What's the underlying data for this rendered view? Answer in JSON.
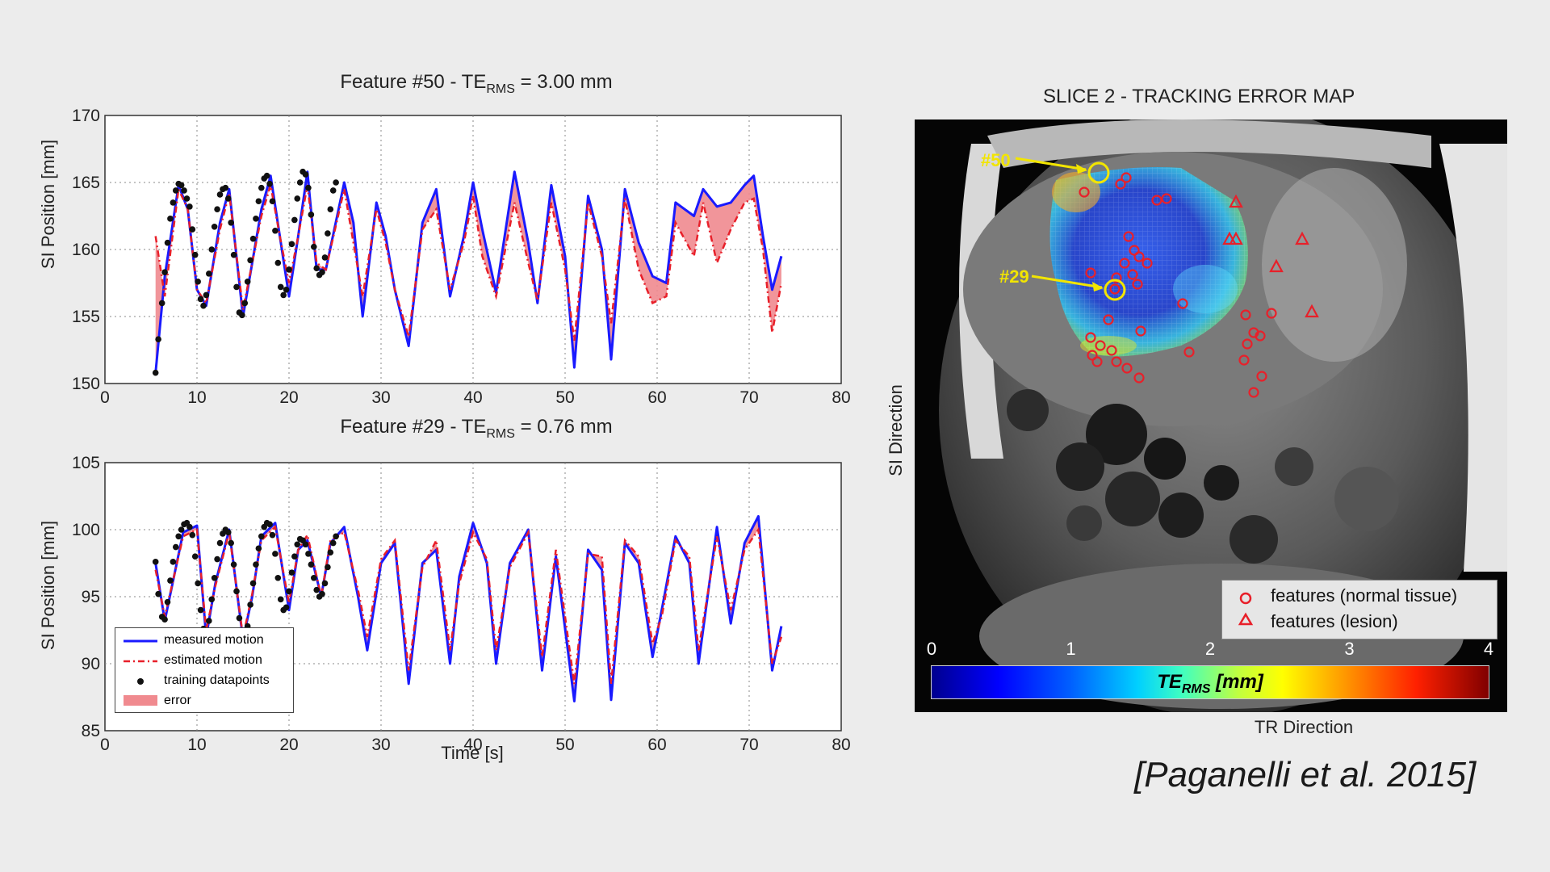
{
  "colors": {
    "measured": "#1a1aff",
    "estimated": "#e8202a",
    "training": "#111111",
    "error_fill": "#f08a8f",
    "feature_marker": "#e8202a",
    "highlight": "#f2e500"
  },
  "chart_data": [
    {
      "type": "line",
      "title_main": "Feature #50 - TE",
      "title_sub": "RMS",
      "title_tail": " = 3.00 mm",
      "xlabel": "",
      "ylabel": "SI Position [mm]",
      "xlim": [
        0,
        80
      ],
      "ylim": [
        150,
        170
      ],
      "xticks": [
        0,
        10,
        20,
        30,
        40,
        50,
        60,
        70,
        80
      ],
      "yticks": [
        150,
        155,
        160,
        165,
        170
      ],
      "grid": true,
      "series": [
        {
          "key": "measured",
          "values_x": [
            5.5,
            6.5,
            8,
            9,
            10,
            11,
            12.5,
            13.5,
            15,
            16,
            17,
            18,
            19,
            20,
            21,
            22,
            23,
            24,
            26,
            27,
            28,
            29.5,
            30.5,
            31.5,
            33,
            34.5,
            36,
            37.5,
            39,
            40,
            41,
            42.5,
            44.5,
            46,
            47,
            48.5,
            50,
            51,
            52.5,
            54,
            55,
            56.5,
            58,
            59.5,
            61,
            62,
            64,
            65,
            66.5,
            68,
            69.5,
            70.5,
            71.5,
            72.5,
            73.5
          ],
          "values_y": [
            150.8,
            158,
            164.8,
            163,
            157,
            155.8,
            162,
            164.5,
            155,
            159,
            163,
            165.5,
            161,
            156.5,
            161,
            165.8,
            158.5,
            158.5,
            165,
            162,
            155,
            163.5,
            161,
            157,
            152.8,
            162,
            164.5,
            156.5,
            161,
            165,
            161.5,
            156.8,
            165.8,
            160.5,
            156,
            164.8,
            159.5,
            151.2,
            164,
            160,
            151.8,
            164.5,
            160.5,
            158,
            157.5,
            163.5,
            162.5,
            164.5,
            163.2,
            163.5,
            164.8,
            165.5,
            161,
            157,
            159.5
          ]
        },
        {
          "key": "estimated",
          "values_x": [
            5.5,
            6.5,
            8,
            9,
            10,
            11,
            12.5,
            13.5,
            15,
            16,
            17,
            18,
            19,
            20,
            21,
            22,
            23,
            24,
            26,
            27,
            28,
            29.5,
            30.5,
            31.5,
            33,
            34.5,
            36,
            37.5,
            39,
            40,
            41,
            42.5,
            44.5,
            46,
            47,
            48.5,
            50,
            51,
            52.5,
            54,
            55,
            56.5,
            58,
            59.5,
            61,
            62,
            64,
            65,
            66.5,
            68,
            69.5,
            70.5,
            71.5,
            72.5,
            73.5
          ],
          "values_y": [
            161,
            156.5,
            164.5,
            163,
            157,
            156,
            161.5,
            164.2,
            155.5,
            159,
            162.5,
            164.8,
            161,
            157.5,
            161,
            164.8,
            159,
            158.5,
            164.5,
            160.5,
            156.5,
            163,
            160.5,
            157,
            153.5,
            161.5,
            163,
            157,
            160.5,
            164,
            159.5,
            156.5,
            163.5,
            159,
            156.2,
            163.5,
            158.5,
            153.2,
            163.5,
            159.5,
            154.5,
            163.8,
            158.5,
            156,
            156.5,
            162,
            159.5,
            163.5,
            159,
            161.5,
            163.5,
            163.8,
            160,
            153.8,
            157.5
          ]
        },
        {
          "key": "training",
          "values_x": [
            5.5,
            5.8,
            6.2,
            6.5,
            6.8,
            7.1,
            7.4,
            7.7,
            8,
            8.3,
            8.6,
            8.9,
            9.2,
            9.5,
            9.8,
            10.1,
            10.4,
            10.7,
            11,
            11.3,
            11.6,
            11.9,
            12.2,
            12.5,
            12.8,
            13.1,
            13.4,
            13.7,
            14,
            14.3,
            14.6,
            14.9,
            15.2,
            15.5,
            15.8,
            16.1,
            16.4,
            16.7,
            17,
            17.3,
            17.6,
            17.9,
            18.2,
            18.5,
            18.8,
            19.1,
            19.4,
            19.7,
            20,
            20.3,
            20.6,
            20.9,
            21.2,
            21.5,
            21.8,
            22.1,
            22.4,
            22.7,
            23,
            23.3,
            23.6,
            23.9,
            24.2,
            24.5,
            24.8,
            25.1
          ],
          "values_y": [
            150.8,
            153.3,
            156,
            158.3,
            160.5,
            162.3,
            163.5,
            164.4,
            164.9,
            164.8,
            164.4,
            163.8,
            163.2,
            161.5,
            159.6,
            157.6,
            156.3,
            155.8,
            156.6,
            158.2,
            160,
            161.7,
            163,
            164.1,
            164.5,
            164.6,
            163.8,
            162,
            159.6,
            157.2,
            155.3,
            155.1,
            156,
            157.6,
            159.2,
            160.8,
            162.3,
            163.6,
            164.6,
            165.3,
            165.5,
            164.9,
            163.6,
            161.4,
            159,
            157.2,
            156.6,
            157,
            158.5,
            160.4,
            162.2,
            163.8,
            165,
            165.8,
            165.6,
            164.6,
            162.6,
            160.2,
            158.6,
            158.1,
            158.3,
            159.4,
            161.2,
            163,
            164.4,
            165
          ]
        }
      ]
    },
    {
      "type": "line",
      "title_main": "Feature #29 - TE",
      "title_sub": "RMS",
      "title_tail": " = 0.76 mm",
      "xlabel": "Time [s]",
      "ylabel": "SI Position [mm]",
      "xlim": [
        0,
        80
      ],
      "ylim": [
        85,
        105
      ],
      "xticks": [
        0,
        10,
        20,
        30,
        40,
        50,
        60,
        70,
        80
      ],
      "yticks": [
        85,
        90,
        95,
        100,
        105
      ],
      "grid": true,
      "legend_placement": "bottom-left",
      "legend": [
        "measured motion",
        "estimated motion",
        "training datapoints",
        "error"
      ],
      "series": [
        {
          "key": "measured",
          "values_x": [
            5.5,
            6.5,
            8.5,
            10,
            11,
            12,
            13.5,
            15,
            16,
            17,
            18.5,
            20,
            21,
            22,
            23.5,
            24.5,
            26,
            27.5,
            28.5,
            30,
            31.5,
            33,
            34.5,
            36,
            37.5,
            38.5,
            40,
            41.5,
            42.5,
            44,
            46,
            47.5,
            49,
            51,
            52.5,
            54,
            55,
            56.5,
            58,
            59.5,
            60.5,
            62,
            63.5,
            64.5,
            66.5,
            68,
            69.5,
            71,
            72.5,
            73.5
          ],
          "values_y": [
            97.5,
            93.2,
            99.8,
            100.3,
            92,
            96,
            100,
            91.8,
            95,
            99.5,
            100.5,
            94,
            98.5,
            99.2,
            95,
            99,
            100.2,
            95,
            91,
            97.5,
            99,
            88.5,
            97.5,
            98.5,
            90,
            96.5,
            100.5,
            97.5,
            90,
            97.5,
            100,
            89.5,
            98,
            87.2,
            98.5,
            97,
            87.3,
            99,
            97.5,
            90.5,
            94,
            99.5,
            97.5,
            90,
            100.2,
            93,
            99,
            101,
            89.5,
            92.8
          ]
        },
        {
          "key": "estimated",
          "values_x": [
            5.5,
            6.5,
            8.5,
            10,
            11,
            12,
            13.5,
            15,
            16,
            17,
            18.5,
            20,
            21,
            22,
            23.5,
            24.5,
            26,
            27.5,
            28.5,
            30,
            31.5,
            33,
            34.5,
            36,
            37.5,
            38.5,
            40,
            41.5,
            42.5,
            44,
            46,
            47.5,
            49,
            51,
            52.5,
            54,
            55,
            56.5,
            58,
            59.5,
            60.5,
            62,
            63.5,
            64.5,
            66.5,
            68,
            69.5,
            71,
            72.5,
            73.5
          ],
          "values_y": [
            97,
            93.5,
            99.5,
            100,
            92.5,
            95.8,
            99.8,
            92,
            95.2,
            99.2,
            100.2,
            94.5,
            98.5,
            99.6,
            95,
            99.2,
            99.8,
            95.5,
            92,
            97.8,
            99.2,
            89.5,
            97.2,
            99.2,
            91,
            96,
            99.8,
            97.8,
            91,
            97.2,
            99.8,
            90.5,
            98.5,
            88.5,
            98.2,
            98,
            88.5,
            99.2,
            98,
            91.5,
            93.5,
            99.2,
            98,
            91,
            99.5,
            94,
            98.5,
            100,
            90,
            92
          ]
        },
        {
          "key": "training",
          "values_x": [
            5.5,
            5.8,
            6.2,
            6.5,
            6.8,
            7.1,
            7.4,
            7.7,
            8,
            8.3,
            8.6,
            8.9,
            9.2,
            9.5,
            9.8,
            10.1,
            10.4,
            10.7,
            11,
            11.3,
            11.6,
            11.9,
            12.2,
            12.5,
            12.8,
            13.1,
            13.4,
            13.7,
            14,
            14.3,
            14.6,
            14.9,
            15.2,
            15.5,
            15.8,
            16.1,
            16.4,
            16.7,
            17,
            17.3,
            17.6,
            17.9,
            18.2,
            18.5,
            18.8,
            19.1,
            19.4,
            19.7,
            20,
            20.3,
            20.6,
            20.9,
            21.2,
            21.5,
            21.8,
            22.1,
            22.4,
            22.7,
            23,
            23.3,
            23.6,
            23.9,
            24.2,
            24.5,
            24.8,
            25.1
          ],
          "values_y": [
            97.6,
            95.2,
            93.5,
            93.3,
            94.6,
            96.2,
            97.6,
            98.7,
            99.5,
            100,
            100.4,
            100.5,
            100.2,
            99.6,
            98,
            96,
            94,
            92.6,
            92.2,
            93.2,
            94.8,
            96.4,
            97.8,
            99,
            99.7,
            100,
            99.8,
            99,
            97.4,
            95.4,
            93.4,
            92,
            91.8,
            92.8,
            94.4,
            96,
            97.4,
            98.6,
            99.5,
            100.2,
            100.5,
            100.4,
            99.6,
            98.2,
            96.4,
            94.8,
            94,
            94.2,
            95.4,
            96.8,
            98,
            98.9,
            99.3,
            99.2,
            98.9,
            98.2,
            97.4,
            96.4,
            95.5,
            95,
            95.2,
            96,
            97.2,
            98.3,
            99,
            99.5
          ]
        }
      ]
    },
    {
      "type": "heatmap",
      "title": "SLICE 2 - TRACKING ERROR MAP",
      "xlabel": "TR Direction",
      "ylabel": "SI Direction",
      "colorbar": {
        "label_main": "TE",
        "label_sub": "RMS",
        "label_tail": " [mm]",
        "min": 0,
        "max": 4,
        "ticks": [
          "0",
          "1",
          "2",
          "3",
          "4"
        ]
      },
      "annotations": [
        "#50",
        "#29"
      ],
      "legend": [
        "features (normal tissue)",
        "features (lesion)"
      ]
    }
  ],
  "citation": "[Paganelli et al. 2015]"
}
